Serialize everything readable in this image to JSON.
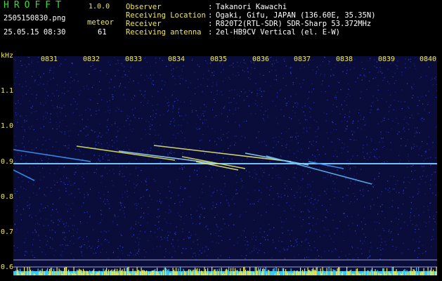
{
  "header": {
    "app_title": "HROFFT",
    "app_version": "1.0.0",
    "file_name": "2505150830.png",
    "meteor_label": "meteor",
    "date_time": "25.05.15 08:30",
    "meteor_count": "61"
  },
  "info": [
    {
      "key": "Observer",
      "sep": ":",
      "value": "Takanori Kawachi"
    },
    {
      "key": "Receiving Location",
      "sep": ":",
      "value": "Ogaki, Gifu, JAPAN (136.60E, 35.35N)"
    },
    {
      "key": "Receiver",
      "sep": ":",
      "value": "R820T2(RTL-SDR) SDR-Sharp 53.372MHz"
    },
    {
      "key": "Receiving antenna",
      "sep": ":",
      "value": "2el-HB9CV Vertical (el. E-W)"
    }
  ],
  "axes": {
    "freq_unit": "kHz",
    "time_ticks": [
      "0831",
      "0832",
      "0833",
      "0834",
      "0835",
      "0836",
      "0837",
      "0838",
      "0839",
      "0840"
    ],
    "freq_ticks": [
      "1.1",
      "1.0",
      "0.9",
      "0.8",
      "0.7",
      "0.6"
    ]
  },
  "colors": {
    "label_green": "#2fe02f",
    "label_yellow": "#f2e94a",
    "background_noise": "#0a0d3a",
    "carrier": "#a8e8ff",
    "meteor_trace": "#f2f27a",
    "level_bar": "#f2e94a",
    "level_base": "#3ec8f0"
  }
}
